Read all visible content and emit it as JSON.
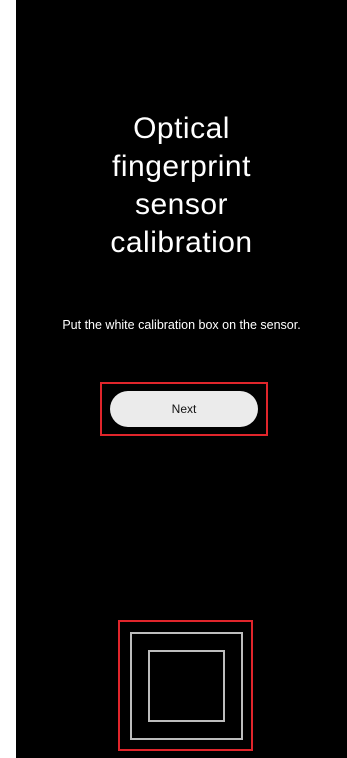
{
  "screen": {
    "title_lines": [
      "Optical",
      "fingerprint",
      "sensor",
      "calibration"
    ],
    "instruction": "Put the white calibration box on the sensor.",
    "next_label": "Next",
    "sensor_icon": "calibration-box-icon"
  },
  "colors": {
    "background": "#000000",
    "text": "#ffffff",
    "button_bg": "#ebebeb",
    "highlight": "#e0252b",
    "sensor_outline": "#bdbdbd"
  }
}
